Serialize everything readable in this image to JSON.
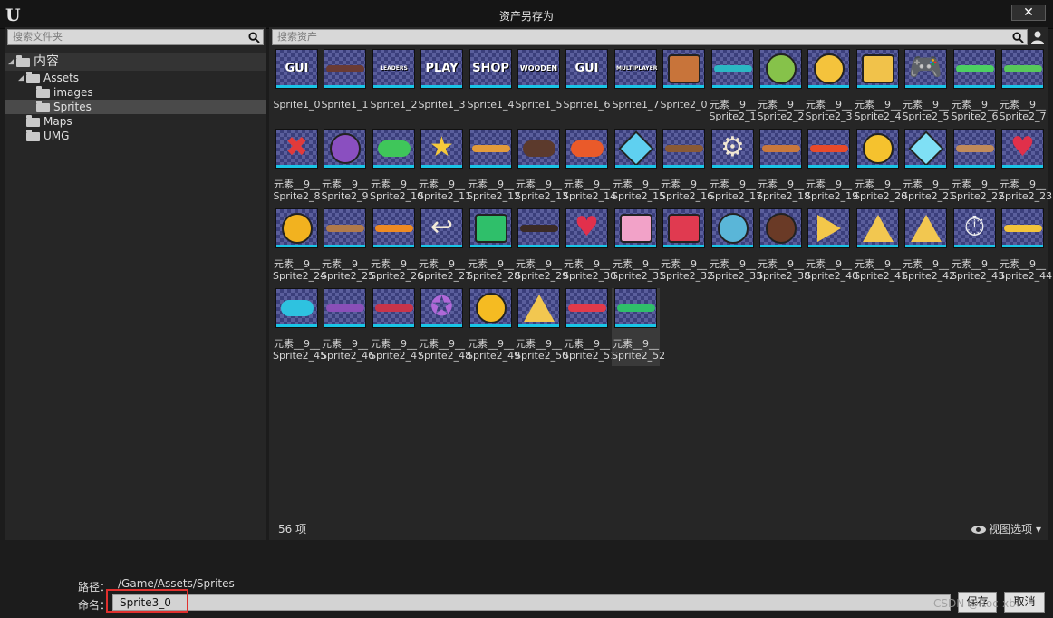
{
  "window": {
    "title": "资产另存为",
    "close_label": "✕"
  },
  "folder_search": {
    "placeholder": "搜索文件夹"
  },
  "asset_search": {
    "placeholder": "搜索资产"
  },
  "tree": [
    {
      "label": "内容",
      "depth": 0,
      "expanded": true,
      "selected": false
    },
    {
      "label": "Assets",
      "depth": 1,
      "expanded": true,
      "selected": false
    },
    {
      "label": "images",
      "depth": 2,
      "expanded": false,
      "selected": false
    },
    {
      "label": "Sprites",
      "depth": 2,
      "expanded": false,
      "selected": true
    },
    {
      "label": "Maps",
      "depth": 1,
      "expanded": false,
      "selected": false
    },
    {
      "label": "UMG",
      "depth": 1,
      "expanded": false,
      "selected": false
    }
  ],
  "assets": [
    {
      "l1": "Sprite1_0",
      "l2": "",
      "art": "word",
      "text": "GUI",
      "c": "#ffffff"
    },
    {
      "l1": "Sprite1_1",
      "l2": "",
      "art": "bar",
      "c": "#6a3b34"
    },
    {
      "l1": "Sprite1_2",
      "l2": "",
      "art": "word",
      "text": "LEADERS",
      "c": "#ffffff"
    },
    {
      "l1": "Sprite1_3",
      "l2": "",
      "art": "word",
      "text": "PLAY",
      "c": "#ffffff"
    },
    {
      "l1": "Sprite1_4",
      "l2": "",
      "art": "word",
      "text": "SHOP",
      "c": "#ffffff"
    },
    {
      "l1": "Sprite1_5",
      "l2": "",
      "art": "word",
      "text": "WOODEN",
      "c": "#ffffff"
    },
    {
      "l1": "Sprite1_6",
      "l2": "",
      "art": "word",
      "text": "GUI",
      "c": "#ffffff"
    },
    {
      "l1": "Sprite1_7",
      "l2": "",
      "art": "word",
      "text": "MULTIPLAYER",
      "c": "#ffffff"
    },
    {
      "l1": "Sprite2_0",
      "l2": "",
      "art": "rect",
      "c": "#c8743a"
    },
    {
      "l1": "元素__9__",
      "l2": "Sprite2_1",
      "art": "bar",
      "c": "#2bb7c3"
    },
    {
      "l1": "元素__9__",
      "l2": "Sprite2_2",
      "art": "circle",
      "c": "#86c24a"
    },
    {
      "l1": "元素__9__",
      "l2": "Sprite2_3",
      "art": "circle",
      "c": "#f4c33c"
    },
    {
      "l1": "元素__9__",
      "l2": "Sprite2_4",
      "art": "rect",
      "c": "#f1c24a"
    },
    {
      "l1": "元素__9__",
      "l2": "Sprite2_5",
      "art": "glyph",
      "text": "🎮",
      "c": "#ffffff"
    },
    {
      "l1": "元素__9__",
      "l2": "Sprite2_6",
      "art": "bar",
      "c": "#4ccf62"
    },
    {
      "l1": "元素__9__",
      "l2": "Sprite2_7",
      "art": "bar",
      "c": "#57c85a"
    },
    {
      "l1": "元素__9__",
      "l2": "Sprite2_8",
      "art": "glyph",
      "text": "✖",
      "c": "#e23a3a"
    },
    {
      "l1": "元素__9__",
      "l2": "Sprite2_9",
      "art": "circle",
      "c": "#8a4fc0"
    },
    {
      "l1": "元素__9__",
      "l2": "Sprite2_10",
      "art": "pill",
      "c": "#3fc65a"
    },
    {
      "l1": "元素__9__",
      "l2": "Sprite2_11",
      "art": "glyph",
      "text": "★",
      "c": "#f6c93a"
    },
    {
      "l1": "元素__9__",
      "l2": "Sprite2_12",
      "art": "bar",
      "c": "#e39b3a"
    },
    {
      "l1": "元素__9__",
      "l2": "Sprite2_13",
      "art": "pill",
      "c": "#5c3a2c"
    },
    {
      "l1": "元素__9__",
      "l2": "Sprite2_14",
      "art": "pill",
      "c": "#ea5a2a"
    },
    {
      "l1": "元素__9__",
      "l2": "Sprite2_15",
      "art": "gem",
      "c": "#5fd0f0"
    },
    {
      "l1": "元素__9__",
      "l2": "Sprite2_16",
      "art": "bar",
      "c": "#8a5a35"
    },
    {
      "l1": "元素__9__",
      "l2": "Sprite2_17",
      "art": "glyph",
      "text": "⚙",
      "c": "#f0e6d2"
    },
    {
      "l1": "元素__9__",
      "l2": "Sprite2_18",
      "art": "bar",
      "c": "#c9783c"
    },
    {
      "l1": "元素__9__",
      "l2": "Sprite2_19",
      "art": "bar",
      "c": "#e84a2a"
    },
    {
      "l1": "元素__9__",
      "l2": "Sprite2_20",
      "art": "circle",
      "c": "#f5c22e"
    },
    {
      "l1": "元素__9__",
      "l2": "Sprite2_21",
      "art": "gem",
      "c": "#7fe0f5"
    },
    {
      "l1": "元素__9__",
      "l2": "Sprite2_22",
      "art": "bar",
      "c": "#c08a5a"
    },
    {
      "l1": "元素__9__",
      "l2": "Sprite2_23",
      "art": "glyph",
      "text": "♥",
      "c": "#e0304a"
    },
    {
      "l1": "元素__9__",
      "l2": "Sprite2_24",
      "art": "circle",
      "c": "#f2b21f"
    },
    {
      "l1": "元素__9__",
      "l2": "Sprite2_25",
      "art": "bar",
      "c": "#b07a4a"
    },
    {
      "l1": "元素__9__",
      "l2": "Sprite2_26",
      "art": "bar",
      "c": "#ee8a22"
    },
    {
      "l1": "元素__9__",
      "l2": "Sprite2_27",
      "art": "glyph",
      "text": "↩",
      "c": "#f3ead8"
    },
    {
      "l1": "元素__9__",
      "l2": "Sprite2_28",
      "art": "rect",
      "c": "#2fbf6a"
    },
    {
      "l1": "元素__9__",
      "l2": "Sprite2_29",
      "art": "bar",
      "c": "#3b2b26"
    },
    {
      "l1": "元素__9__",
      "l2": "Sprite2_30",
      "art": "glyph",
      "text": "♥",
      "c": "#e2304c"
    },
    {
      "l1": "元素__9__",
      "l2": "Sprite2_31",
      "art": "rect",
      "c": "#f2a2c8"
    },
    {
      "l1": "元素__9__",
      "l2": "Sprite2_32",
      "art": "rect",
      "c": "#e03a50"
    },
    {
      "l1": "元素__9__",
      "l2": "Sprite2_33",
      "art": "circle",
      "c": "#5ab6d8"
    },
    {
      "l1": "元素__9__",
      "l2": "Sprite2_38",
      "art": "circle",
      "c": "#6a3a26"
    },
    {
      "l1": "元素__9__",
      "l2": "Sprite2_40",
      "art": "play",
      "c": "#f3c74a"
    },
    {
      "l1": "元素__9__",
      "l2": "Sprite2_41",
      "art": "tri",
      "c": "#f2c750"
    },
    {
      "l1": "元素__9__",
      "l2": "Sprite2_42",
      "art": "tri",
      "c": "#f2c750"
    },
    {
      "l1": "元素__9__",
      "l2": "Sprite2_43",
      "art": "glyph",
      "text": "⏱",
      "c": "#f0f0f0"
    },
    {
      "l1": "元素__9__",
      "l2": "Sprite2_44",
      "art": "bar",
      "c": "#f2c33a"
    },
    {
      "l1": "元素__9__",
      "l2": "Sprite2_45",
      "art": "pill",
      "c": "#2ec2e0"
    },
    {
      "l1": "元素__9__",
      "l2": "Sprite2_46",
      "art": "bar",
      "c": "#8a4fb8"
    },
    {
      "l1": "元素__9__",
      "l2": "Sprite2_47",
      "art": "bar",
      "c": "#c8344a"
    },
    {
      "l1": "元素__9__",
      "l2": "Sprite2_48",
      "art": "glyph",
      "text": "✪",
      "c": "#b068d8"
    },
    {
      "l1": "元素__9__",
      "l2": "Sprite2_49",
      "art": "circle",
      "c": "#f5bb22"
    },
    {
      "l1": "元素__9__",
      "l2": "Sprite2_50",
      "art": "tri",
      "c": "#f2c750"
    },
    {
      "l1": "元素__9__",
      "l2": "Sprite2_51",
      "art": "bar",
      "c": "#e23a4a"
    },
    {
      "l1": "元素__9__",
      "l2": "Sprite2_52",
      "art": "bar",
      "c": "#2fbf6a",
      "selected": true
    }
  ],
  "footer": {
    "count": "56 项",
    "view_options": "视图选项",
    "path_label": "路径：",
    "path_value": "/Game/Assets/Sprites",
    "name_label": "命名：",
    "name_value": "Sprite3_0",
    "save_label": "保存",
    "cancel_label": "取消",
    "watermark": "CSDN @Roc-xb"
  }
}
